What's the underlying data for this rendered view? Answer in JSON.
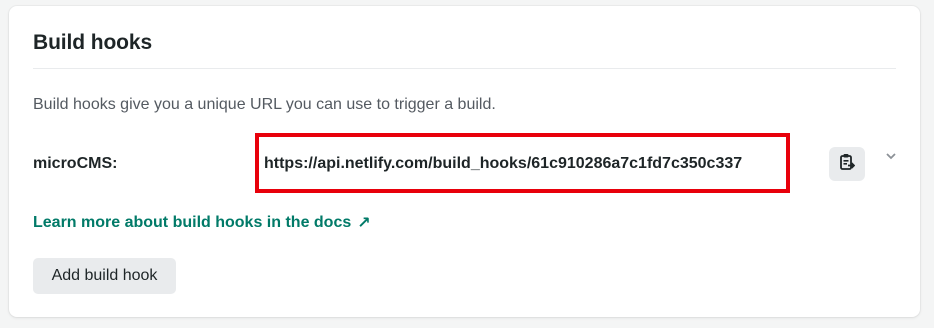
{
  "section": {
    "title": "Build hooks",
    "description": "Build hooks give you a unique URL you can use to trigger a build."
  },
  "hooks": [
    {
      "name": "microCMS:",
      "url": "https://api.netlify.com/build_hooks/61c910286a7c1fd7c350c337"
    }
  ],
  "links": {
    "docs_label": "Learn more about build hooks in the docs",
    "docs_arrow": "↗"
  },
  "actions": {
    "add_hook_label": "Add build hook"
  },
  "icons": {
    "copy": "clipboard-copy-icon",
    "expand": "chevron-down-icon",
    "external": "external-arrow-icon"
  },
  "colors": {
    "link": "#017a68",
    "highlight_border": "#e8000b",
    "button_bg": "#e9ebed"
  }
}
